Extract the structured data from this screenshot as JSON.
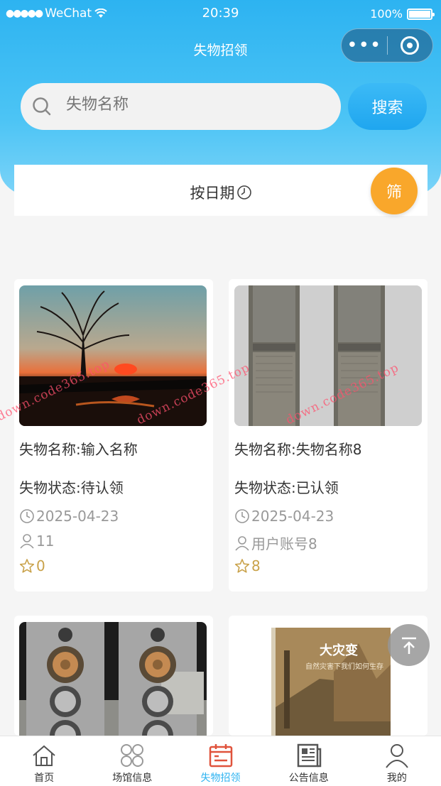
{
  "status_bar": {
    "signal": "●●●●●",
    "carrier": "WeChat",
    "time": "20:39",
    "battery": "100%"
  },
  "nav": {
    "title": "失物招领"
  },
  "search": {
    "placeholder": "失物名称",
    "button_label": "搜索"
  },
  "filter": {
    "sort_label": "按日期",
    "filter_button_label": "筛"
  },
  "cards": [
    {
      "name_label": "失物名称:输入名称",
      "status_label": "失物状态:待认领",
      "date": "2025-04-23",
      "user": "11",
      "likes": "0"
    },
    {
      "name_label": "失物名称:失物名称8",
      "status_label": "失物状态:已认领",
      "date": "2025-04-23",
      "user": "用户账号8",
      "likes": "8"
    }
  ],
  "book": {
    "title": "大灾变",
    "subtitle": "自然灾害下我们如何生存"
  },
  "watermark": "down.code365.top",
  "tabbar": [
    {
      "label": "首页",
      "icon": "home-icon"
    },
    {
      "label": "场馆信息",
      "icon": "grid-icon"
    },
    {
      "label": "失物招领",
      "icon": "calendar-icon",
      "active": true
    },
    {
      "label": "公告信息",
      "icon": "newspaper-icon"
    },
    {
      "label": "我的",
      "icon": "user-icon"
    }
  ],
  "colors": {
    "primary": "#2db3f1",
    "filter_button": "#f9a72b",
    "likes": "#c9a24a"
  }
}
